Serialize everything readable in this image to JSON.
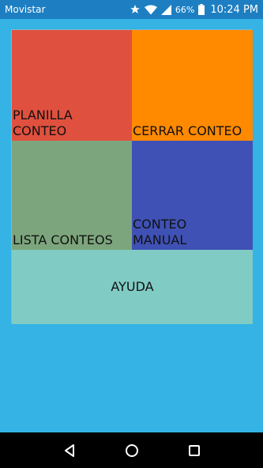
{
  "status_bar": {
    "carrier": "Movistar",
    "battery_percent": "66%",
    "time": "10:24 PM",
    "icons": [
      "star-icon",
      "wifi-icon",
      "signal-icon",
      "battery-icon"
    ]
  },
  "tiles": {
    "planilla": {
      "label": "PLANILLA\nCONTEO",
      "color": "#e0503e"
    },
    "cerrar": {
      "label": "CERRAR CONTEO",
      "color": "#ff8a00"
    },
    "lista": {
      "label": "LISTA CONTEOS",
      "color": "#7da57d"
    },
    "manual": {
      "label": "CONTEO\nMANUAL",
      "color": "#3f51b5"
    },
    "ayuda": {
      "label": "AYUDA",
      "color": "#80cbc4"
    }
  },
  "nav_bar": {
    "buttons": [
      "back-icon",
      "home-icon",
      "recents-icon"
    ]
  },
  "colors": {
    "background": "#34b3e4",
    "status_bar": "#1d7fc2",
    "nav_bar": "#000000"
  }
}
